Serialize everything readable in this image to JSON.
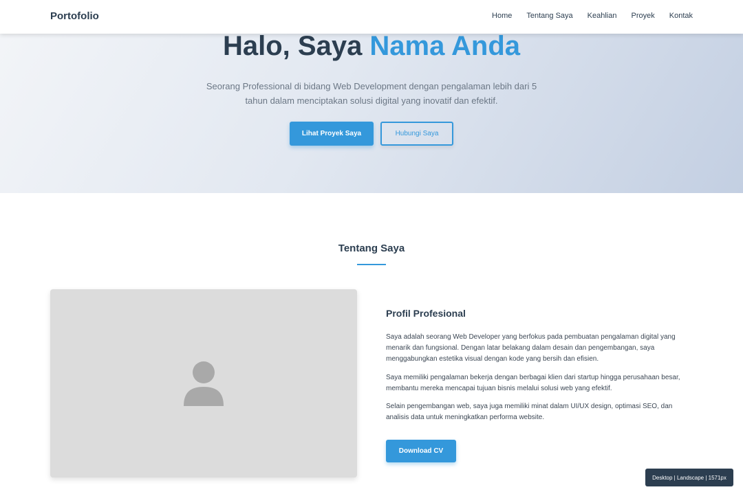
{
  "navbar": {
    "brand": "Portofolio",
    "links": [
      "Home",
      "Tentang Saya",
      "Keahlian",
      "Proyek",
      "Kontak"
    ]
  },
  "hero": {
    "title_prefix": "Halo, Saya ",
    "title_accent": "Nama Anda",
    "description": "Seorang Professional di bidang Web Development dengan pengalaman lebih dari 5 tahun dalam menciptakan solusi digital yang inovatif dan efektif.",
    "primary_button": "Lihat Proyek Saya",
    "secondary_button": "Hubungi Saya"
  },
  "about": {
    "section_title": "Tentang Saya",
    "photo_icon": "person-icon",
    "profile_heading": "Profil Profesional",
    "paragraphs": [
      "Saya adalah seorang Web Developer yang berfokus pada pembuatan pengalaman digital yang menarik dan fungsional. Dengan latar belakang dalam desain dan pengembangan, saya menggabungkan estetika visual dengan kode yang bersih dan efisien.",
      "Saya memiliki pengalaman bekerja dengan berbagai klien dari startup hingga perusahaan besar, membantu mereka mencapai tujuan bisnis melalui solusi web yang efektif.",
      "Selain pengembangan web, saya juga memiliki minat dalam UI/UX design, optimasi SEO, dan analisis data untuk meningkatkan performa website."
    ],
    "cv_button": "Download CV"
  },
  "viewport_badge": "Desktop | Landscape | 1571px",
  "colors": {
    "accent": "#3498db",
    "text_dark": "#2c3e50",
    "photo_placeholder": "#dcdcdc",
    "badge_bg": "#2c3e50"
  }
}
